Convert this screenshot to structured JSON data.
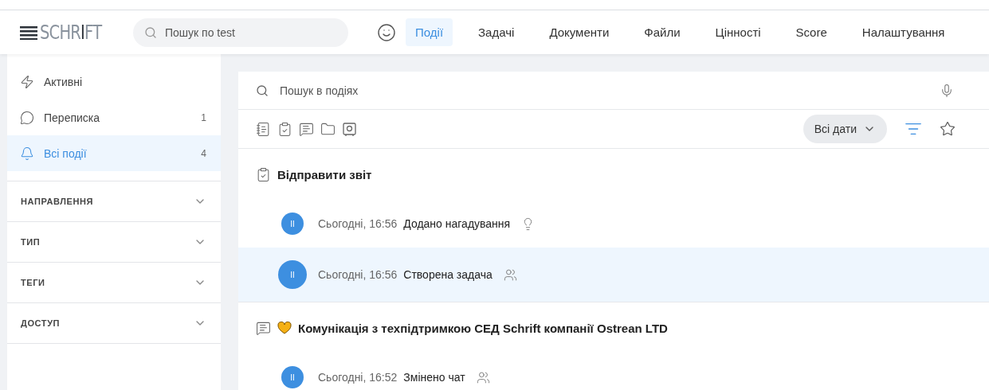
{
  "header": {
    "logo": "SCHR**I**FT",
    "search": {
      "placeholder": "Пошук по test"
    },
    "nav": [
      {
        "label": "Події",
        "selected": true
      },
      {
        "label": "Задачі",
        "selected": false
      },
      {
        "label": "Документи",
        "selected": false
      },
      {
        "label": "Файли",
        "selected": false
      },
      {
        "label": "Цінності",
        "selected": false
      },
      {
        "label": "Score",
        "selected": false
      },
      {
        "label": "Налаштування",
        "selected": false
      }
    ]
  },
  "sidebar": {
    "items": [
      {
        "kind": "bolt",
        "label": "Активні",
        "selected": false
      },
      {
        "kind": "chat",
        "label": "Переписка",
        "count": "1",
        "selected": false
      },
      {
        "kind": "bell",
        "label": "Всі події",
        "count": "4",
        "selected": true
      }
    ],
    "filters": [
      {
        "label": "НАПРАВЛЕННЯ",
        "expanded": false
      },
      {
        "label": "ТИП",
        "expanded": false
      },
      {
        "label": "ТЕГИ",
        "expanded": false
      },
      {
        "label": "ДОСТУП",
        "expanded": false
      }
    ]
  },
  "main": {
    "search": {
      "placeholder": "Пошук в подіях"
    },
    "date_filter": "Всі дати",
    "groups": [
      {
        "kind": "task",
        "title": "Відправити звіт",
        "events": [
          {
            "avatar": "II",
            "time": "Сьогодні, 16:56",
            "text": "Додано нагадування",
            "kind": "bulb",
            "selected": false
          },
          {
            "avatar": "II",
            "time": "Сьогодні, 16:56",
            "text": "Створена задача",
            "kind": "people",
            "selected": true
          }
        ]
      },
      {
        "kind": "chat",
        "emoji": true,
        "title": "Комунікація з техпідтримкою СЕД Schrift компанії Ostrean LTD",
        "events": [
          {
            "avatar": "II",
            "time": "Сьогодні, 16:52",
            "text": "Змінено чат",
            "kind": "people",
            "selected": false
          }
        ]
      }
    ]
  }
}
